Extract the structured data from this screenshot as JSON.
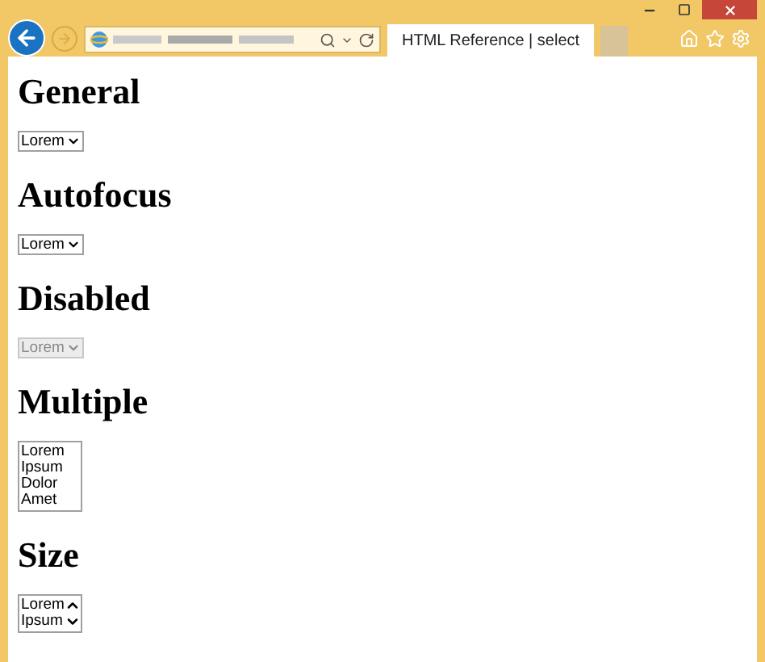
{
  "browser": {
    "tab": {
      "title": "HTML Reference | select",
      "selected": true
    }
  },
  "sections": [
    {
      "heading": "General",
      "kind": "dropdown",
      "disabled": false,
      "options": [
        "Lorem"
      ]
    },
    {
      "heading": "Autofocus",
      "kind": "dropdown",
      "disabled": false,
      "options": [
        "Lorem"
      ]
    },
    {
      "heading": "Disabled",
      "kind": "dropdown",
      "disabled": true,
      "options": [
        "Lorem"
      ]
    },
    {
      "heading": "Multiple",
      "kind": "listbox",
      "disabled": false,
      "options": [
        "Lorem",
        "Ipsum",
        "Dolor",
        "Amet"
      ]
    },
    {
      "heading": "Size",
      "kind": "scrolllist",
      "disabled": false,
      "options": [
        "Lorem",
        "Ipsum"
      ]
    }
  ]
}
